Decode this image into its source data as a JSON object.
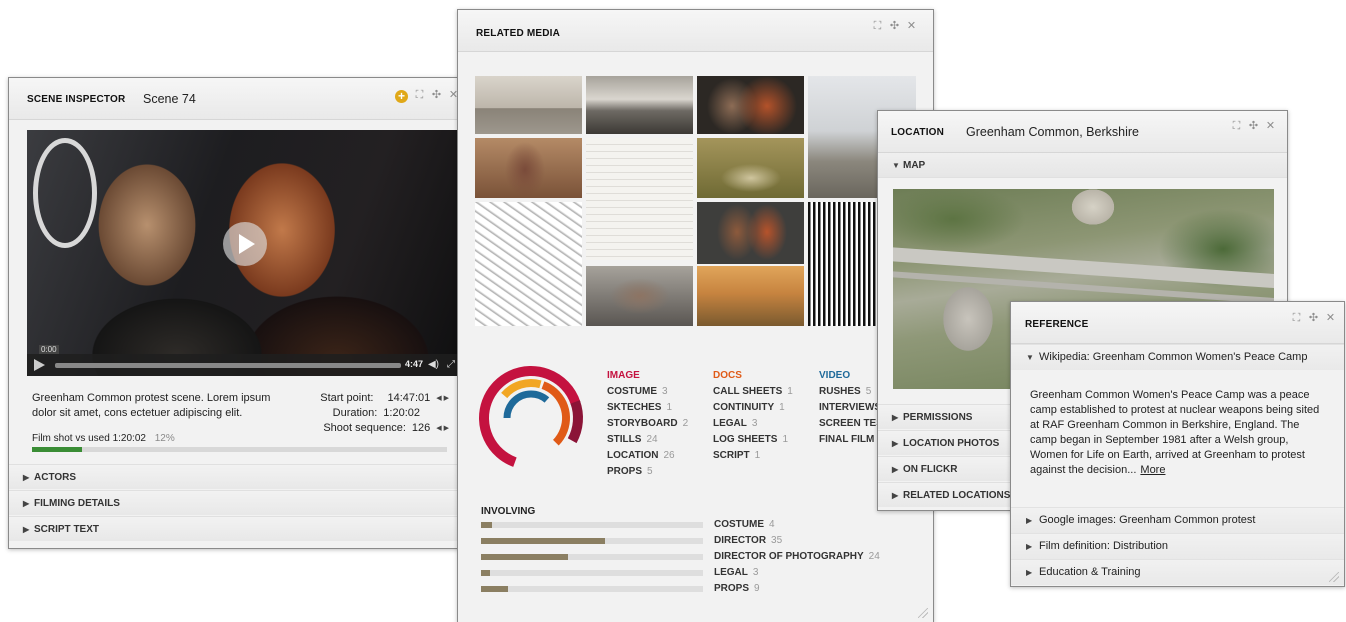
{
  "scene_inspector": {
    "title": "SCENE INSPECTOR",
    "scene": "Scene 74",
    "video": {
      "current_time": "0:00",
      "duration": "4:47"
    },
    "description": "Greenham Common protest scene. Lorem ipsum dolor sit amet, cons ectetuer adipiscing elit.",
    "start_point_label": "Start point:",
    "start_point": "14:47:01",
    "duration_label": "Duration:",
    "duration": "1:20:02",
    "shoot_sequence_label": "Shoot sequence:",
    "shoot_sequence": "126",
    "usage_label": "Film shot vs used",
    "usage_time": "1:20:02",
    "usage_percent_text": "12%",
    "usage_fraction": 0.12,
    "sections": [
      "ACTORS",
      "FILMING DETAILS",
      "SCRIPT TEXT"
    ],
    "colors": {
      "accent_add": "#e0a818",
      "progress": "#3a8d35"
    }
  },
  "related_media": {
    "title": "RELATED MEDIA",
    "categories": [
      {
        "head": "IMAGE",
        "color": "#c4123f",
        "items": [
          {
            "label": "COSTUME",
            "count": "3"
          },
          {
            "label": "SKTECHES",
            "count": "1"
          },
          {
            "label": "STORYBOARD",
            "count": "2"
          },
          {
            "label": "STILLS",
            "count": "24"
          },
          {
            "label": "LOCATION",
            "count": "26"
          },
          {
            "label": "PROPS",
            "count": "5"
          }
        ]
      },
      {
        "head": "DOCS",
        "color": "#e05a17",
        "items": [
          {
            "label": "CALL SHEETS",
            "count": "1"
          },
          {
            "label": "CONTINUITY",
            "count": "1"
          },
          {
            "label": "LEGAL",
            "count": "3"
          },
          {
            "label": "LOG SHEETS",
            "count": "1"
          },
          {
            "label": "SCRIPT",
            "count": "1"
          }
        ]
      },
      {
        "head": "VIDEO",
        "color": "#1f6a9a",
        "items": [
          {
            "label": "RUSHES",
            "count": "5"
          },
          {
            "label": "INTERVIEWS",
            "count": ""
          },
          {
            "label": "SCREEN TES",
            "count": ""
          },
          {
            "label": "FINAL FILM",
            "count": ""
          }
        ]
      }
    ],
    "involving_title": "INVOLVING",
    "involving": [
      {
        "label": "COSTUME",
        "count": "4",
        "fraction": 0.05
      },
      {
        "label": "DIRECTOR",
        "count": "35",
        "fraction": 0.56
      },
      {
        "label": "DIRECTOR OF PHOTOGRAPHY",
        "count": "24",
        "fraction": 0.39
      },
      {
        "label": "LEGAL",
        "count": "3",
        "fraction": 0.04
      },
      {
        "label": "PROPS",
        "count": "9",
        "fraction": 0.12
      }
    ],
    "thumb_icons": [
      "wall-photo",
      "protest-photo",
      "women-car-photo",
      "pylon-photo",
      "doorway-photo",
      "negative-report-doc",
      "fountain-photo",
      "protest-crowd-photo",
      "map-sketch",
      "car-women-photo",
      "barcode-doc",
      "hands-photo",
      "landscape-painting"
    ]
  },
  "location": {
    "title": "LOCATION",
    "place": "Greenham Common, Berkshire",
    "map_label": "MAP",
    "sections": [
      "PERMISSIONS",
      "LOCATION PHOTOS",
      "ON FLICKR",
      "RELATED LOCATIONS"
    ]
  },
  "reference": {
    "title": "REFERENCE",
    "open_item": "Wikipedia: Greenham Common Women's Peace Camp",
    "text": "Greenham Common Women's Peace Camp was a peace camp established to protest at nuclear weapons being sited at RAF Greenham Common in Berkshire, England. The camp began in September 1981 after a Welsh group, Women for Life on Earth, arrived at Greenham to protest against the decision...",
    "more": "More",
    "links": [
      "Google images: Greenham Common protest",
      "Film definition: Distribution",
      "Education & Training"
    ]
  },
  "window_icons": {
    "maximize": "⛶",
    "move": "✣",
    "close": "✕"
  }
}
